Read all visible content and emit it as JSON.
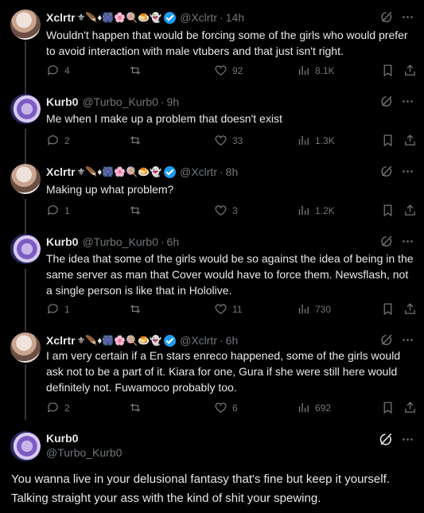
{
  "tweets": [
    {
      "name": "Xclrtr",
      "emojis": "⚜🪶♦🎆🌸🍭🍮👻",
      "handle": "@Xclrtr",
      "time": "14h",
      "verified": true,
      "text": "Wouldn't happen that would be forcing some of the girls who would prefer to avoid interaction with male vtubers and that just isn't right.",
      "replies": "4",
      "retweets": "",
      "likes": "92",
      "views": "8.1K"
    },
    {
      "name": "Kurb0",
      "emojis": "",
      "handle": "@Turbo_Kurb0",
      "time": "9h",
      "verified": false,
      "text": "Me when I make up a problem that doesn't exist",
      "replies": "2",
      "retweets": "",
      "likes": "33",
      "views": "1.3K"
    },
    {
      "name": "Xclrtr",
      "emojis": "⚜🪶♦🎆🌸🍭🍮👻",
      "handle": "@Xclrtr",
      "time": "8h",
      "verified": true,
      "text": "Making up what problem?",
      "replies": "1",
      "retweets": "",
      "likes": "3",
      "views": "1.2K"
    },
    {
      "name": "Kurb0",
      "emojis": "",
      "handle": "@Turbo_Kurb0",
      "time": "6h",
      "verified": false,
      "text": "The idea that some of the girls would be so against the idea of being in the same server as man that Cover would have to force them. Newsflash, not a single person is like that in Hololive.",
      "replies": "1",
      "retweets": "",
      "likes": "11",
      "views": "730"
    },
    {
      "name": "Xclrtr",
      "emojis": "⚜🪶♦🎆🌸🍭🍮👻",
      "handle": "@Xclrtr",
      "time": "6h",
      "verified": true,
      "text": "I am very certain if a En stars enreco happened, some of the girls would ask not to be a part of it. Kiara for one, Gura if she were still here would definitely not. Fuwamoco probably too.",
      "replies": "2",
      "retweets": "",
      "likes": "6",
      "views": "692"
    }
  ],
  "main_tweet": {
    "name": "Kurb0",
    "handle": "@Turbo_Kurb0",
    "text": "You wanna live in your delusional fantasy that's fine but keep it yourself. Talking straight your ass with the kind of shit your spewing."
  },
  "separator": "·",
  "icons": {
    "grok": "grok-icon",
    "more": "more-icon",
    "reply": "reply-icon",
    "retweet": "retweet-icon",
    "like": "heart-icon",
    "views": "views-icon",
    "bookmark": "bookmark-icon",
    "share": "share-icon"
  },
  "colors": {
    "background": "#000000",
    "text": "#e7e9ea",
    "muted": "#71767b",
    "verified": "#1d9bf0",
    "thread_line": "#333639"
  }
}
